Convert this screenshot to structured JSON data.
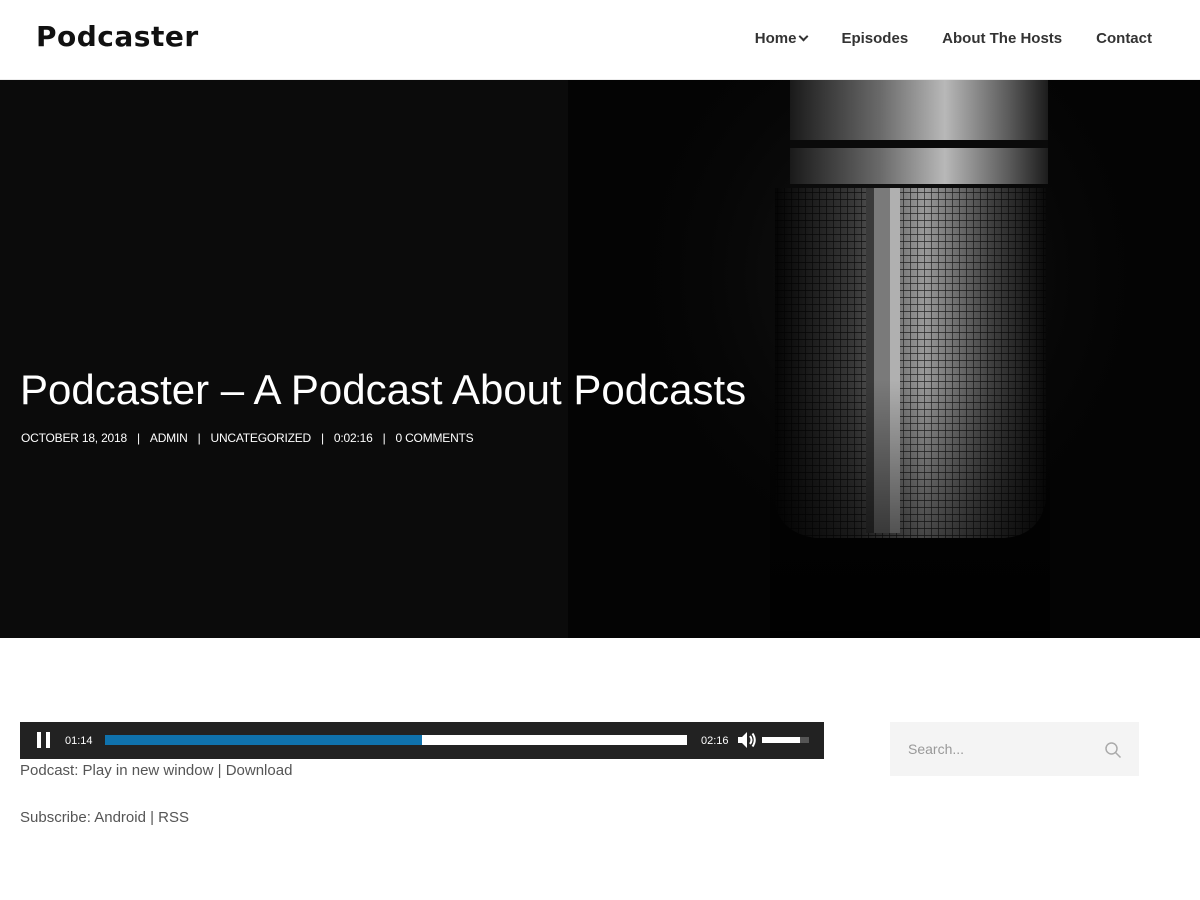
{
  "header": {
    "logo": "Podcaster",
    "nav": {
      "home": "Home",
      "episodes": "Episodes",
      "about": "About The Hosts",
      "contact": "Contact"
    }
  },
  "hero": {
    "title": "Podcaster – A Podcast About Podcasts",
    "meta": {
      "date": "OCTOBER 18, 2018",
      "author": "ADMIN",
      "category": "UNCATEGORIZED",
      "duration": "0:02:16",
      "comments": "0 COMMENTS",
      "separator": "|"
    }
  },
  "player": {
    "current_time": "01:14",
    "duration": "02:16",
    "progress_fraction": 0.544,
    "volume_fraction": 0.8,
    "progress_color": "#0f72ad"
  },
  "podcast_links": {
    "label": "Podcast:",
    "play_new_window": "Play in new window",
    "separator": "|",
    "download": "Download"
  },
  "subscribe_links": {
    "label": "Subscribe:",
    "android": "Android",
    "separator": "|",
    "rss": "RSS"
  },
  "search": {
    "placeholder": "Search...",
    "icon": "search-icon"
  }
}
